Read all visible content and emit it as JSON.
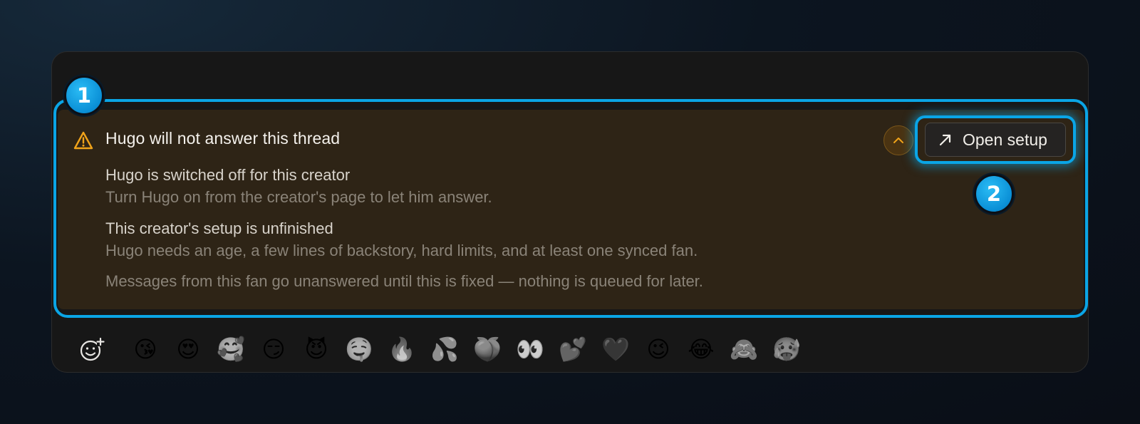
{
  "alert": {
    "title": "Hugo will not answer this thread",
    "reasons": [
      {
        "title": "Hugo is switched off for this creator",
        "description": "Turn Hugo on from the creator's page to let him answer."
      },
      {
        "title": "This creator's setup is unfinished",
        "description": "Hugo needs an age, a few lines of backstory, hard limits, and at least one synced fan."
      }
    ],
    "footnote": "Messages from this fan go unanswered until this is fixed — nothing is queued for later.",
    "open_setup_label": "Open setup",
    "warning_color": "#f0a31a"
  },
  "callouts": {
    "first": "1",
    "second": "2"
  },
  "emoji_bar": {
    "add_icon": "add-emoji-icon",
    "emojis": [
      "😘",
      "😍",
      "🥰",
      "😏",
      "😈",
      "🤤",
      "🔥",
      "💦",
      "🍑",
      "👀",
      "💕",
      "🖤",
      "😉",
      "😂",
      "🙈",
      "🥵"
    ]
  },
  "colors": {
    "accent": "#0aa5e6",
    "panel": "#171717",
    "alert_bg": "#2e2416"
  }
}
